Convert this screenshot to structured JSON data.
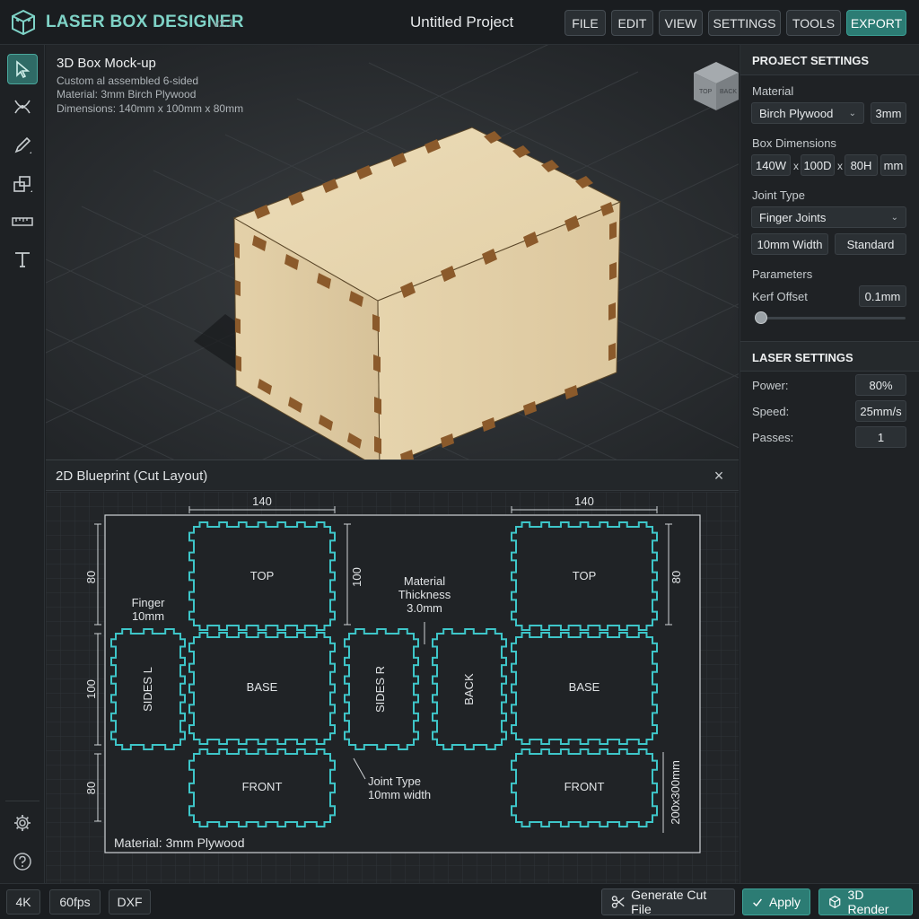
{
  "app": {
    "name": "LASER BOX DESIGNER",
    "version": "v2.1",
    "project_title": "Untitled Project"
  },
  "menu": {
    "file": "FILE",
    "edit": "EDIT",
    "view": "VIEW",
    "settings": "SETTINGS",
    "tools": "TOOLS",
    "export": "EXPORT"
  },
  "tools": [
    "select-icon",
    "node-edit-icon",
    "pen-icon",
    "shapes-icon",
    "ruler-icon",
    "text-icon",
    "gear-icon",
    "help-icon"
  ],
  "viewport": {
    "title": "3D Box Mock-up",
    "line1": "Custom al assembled 6-sided",
    "line2": "Material: 3mm Birch Plywood",
    "line3": "Dimensions: 140mm x 100mm x 80mm",
    "cube_face_left": "TOP",
    "cube_face_right": "BACK"
  },
  "blueprint": {
    "title": "2D Blueprint (Cut Layout)",
    "close": "×",
    "dim_140_left": "140",
    "dim_140_right": "140",
    "dim_80_top": "80",
    "dim_100_left": "100",
    "dim_80_bottom": "80",
    "dim_100_center": "100",
    "dim_80_right": "80",
    "finger_line1": "Finger",
    "finger_line2": "10mm",
    "thickness_line1": "Material",
    "thickness_line2": "Thickness",
    "thickness_line3": "3.0mm",
    "joint_line1": "Joint Type",
    "joint_line2": "10mm width",
    "sheet_size": "200x300mm",
    "material_footer": "Material: 3mm Plywood",
    "parts": {
      "top1": "TOP",
      "top2": "TOP",
      "base1": "BASE",
      "base2": "BASE",
      "front1": "FRONT",
      "front2": "FRONT",
      "sides_l": "SIDES L",
      "sides_r": "SIDES R",
      "back": "BACK"
    }
  },
  "project_settings": {
    "heading": "PROJECT SETTINGS",
    "material_label": "Material",
    "material_value": "Birch Plywood",
    "thickness_value": "3mm",
    "dims_label": "Box Dimensions",
    "width": "140W",
    "depth": "100D",
    "height": "80H",
    "sep": "x",
    "unit": "mm",
    "joint_label": "Joint Type",
    "joint_value": "Finger Joints",
    "joint_width": "10mm Width",
    "joint_style": "Standard",
    "params_label": "Parameters",
    "kerf_label": "Kerf Offset",
    "kerf_value": "0.1mm"
  },
  "laser_settings": {
    "heading": "LASER SETTINGS",
    "power_label": "Power:",
    "power_value": "80%",
    "speed_label": "Speed:",
    "speed_value": "25mm/s",
    "passes_label": "Passes:",
    "passes_value": "1"
  },
  "bottom": {
    "res": "4K",
    "fps": "60fps",
    "format": "DXF",
    "generate": "Generate Cut File",
    "apply": "Apply",
    "render": "3D Render"
  },
  "colors": {
    "accent": "#2c7c74",
    "cut_line": "#3ec6c9",
    "wood": "#e2cfa6"
  }
}
